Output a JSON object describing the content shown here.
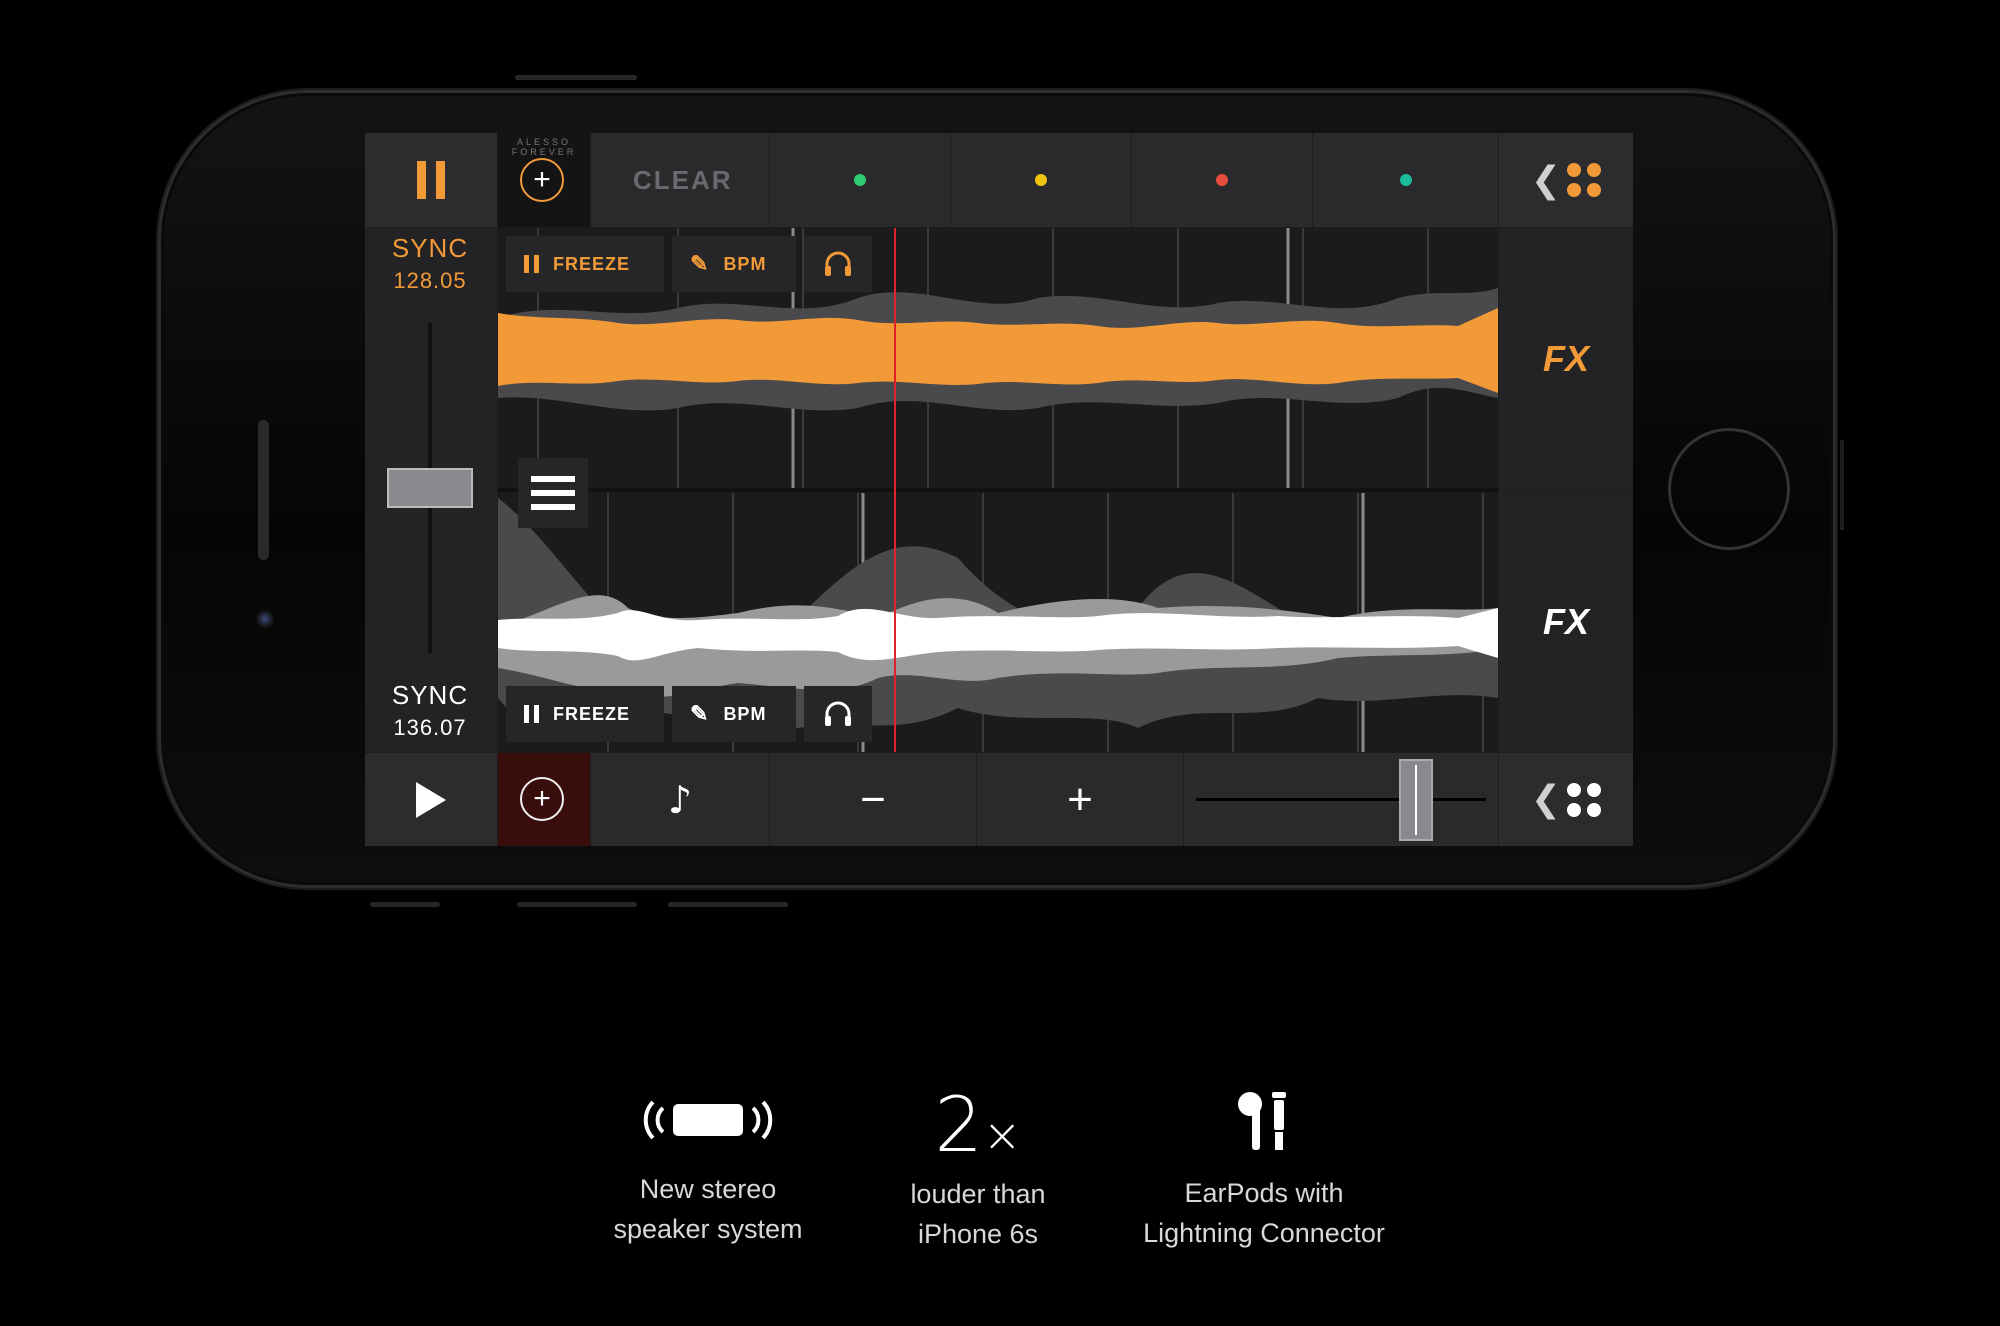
{
  "deck_a": {
    "sync_label": "SYNC",
    "bpm": "128.05",
    "freeze_label": "FREEZE",
    "bpm_label": "BPM",
    "fx_label": "FX",
    "color": "#f29a38"
  },
  "deck_b": {
    "sync_label": "SYNC",
    "bpm": "136.07",
    "freeze_label": "FREEZE",
    "bpm_label": "BPM",
    "fx_label": "FX",
    "color": "#ffffff"
  },
  "topbar": {
    "clear_label": "CLEAR",
    "album_text": "ALESSO FOREVER",
    "cue_colors": [
      "#2ecc71",
      "#f1c40f",
      "#e74c3c",
      "#1abc9c"
    ]
  },
  "bottombar": {
    "minus": "−",
    "plus": "+",
    "crossfader_position": 0.76
  },
  "icons": {
    "pause": "pause-icon",
    "add": "add-icon",
    "edit": "edit-icon",
    "headphones": "headphones-icon",
    "play": "play-icon",
    "note": "music-note-icon",
    "menu": "menu-icon",
    "grid": "grid-dots-icon"
  },
  "features": [
    {
      "caption_line1": "New stereo",
      "caption_line2": "speaker system"
    },
    {
      "title": "2",
      "title_suffix": "×",
      "caption_line1": "louder than",
      "caption_line2": "iPhone 6s"
    },
    {
      "caption_line1": "EarPods with",
      "caption_line2": "Lightning Connector"
    }
  ]
}
